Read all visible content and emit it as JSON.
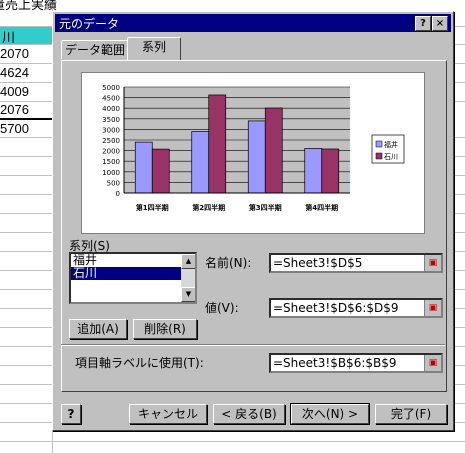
{
  "sheet": {
    "title_fragment": "量売上実績",
    "header_cell": "川",
    "cells": [
      "2070",
      "4624",
      "4009",
      "2076",
      "5700"
    ]
  },
  "dialog": {
    "title": "元のデータ",
    "help_label": "?",
    "close_label": "×",
    "tabs": [
      "データ範囲",
      "系列"
    ],
    "series_label": "系列(S)",
    "series_items": [
      "福井",
      "石川"
    ],
    "name_label": "名前(N):",
    "name_value": "=Sheet3!$D$5",
    "values_label": "値(V):",
    "values_value": "=Sheet3!$D$6:$D$9",
    "axis_label": "項目軸ラベルに使用(T):",
    "axis_value": "=Sheet3!$B$6:$B$9",
    "add_button": "追加(A)",
    "delete_button": "削除(R)",
    "cancel_button": "キャンセル",
    "back_button": "< 戻る(B)",
    "next_button": "次へ(N) >",
    "finish_button": "完了(F)",
    "help_icon_label": "?"
  },
  "chart_data": {
    "type": "bar",
    "categories": [
      "第1四半期",
      "第2四半期",
      "第3四半期",
      "第4四半期"
    ],
    "series": [
      {
        "name": "福井",
        "values": [
          2400,
          2900,
          3400,
          2100
        ],
        "color": "#9999ff"
      },
      {
        "name": "石川",
        "values": [
          2070,
          4624,
          4009,
          2076
        ],
        "color": "#993366"
      }
    ],
    "ylim": [
      0,
      5000
    ],
    "yticks": [
      0,
      500,
      1000,
      1500,
      2000,
      2500,
      3000,
      3500,
      4000,
      4500,
      5000
    ],
    "grid": true,
    "legend": "right",
    "plot_bg": "#c0c0c0"
  }
}
